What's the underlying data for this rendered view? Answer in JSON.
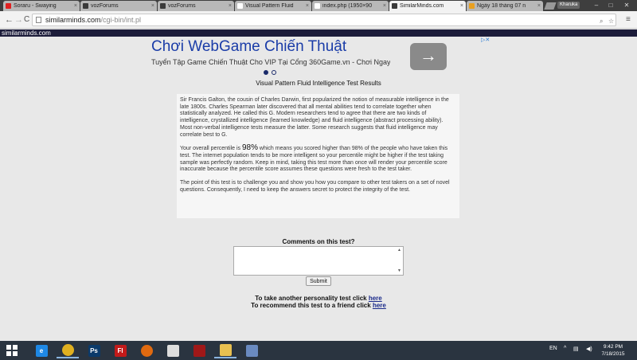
{
  "browser": {
    "tabs": [
      {
        "label": "Soraru - Swaying",
        "favicon_color": "#e02020"
      },
      {
        "label": "vozForums",
        "favicon_color": "#3a3a3a"
      },
      {
        "label": "vozForums",
        "favicon_color": "#3a3a3a"
      },
      {
        "label": "Visual Pattern Fluid",
        "favicon_color": "#ffffff"
      },
      {
        "label": "index.php (1950×90",
        "favicon_color": "#ffffff"
      },
      {
        "label": "SimilarMinds.com",
        "favicon_color": "#3a3a3a"
      },
      {
        "label": "Ngày 18 tháng 07 n",
        "favicon_color": "#e9a020"
      }
    ],
    "active_tab": 5,
    "tab_close": "×",
    "user_badge": "Kharuka",
    "url_host": "similarminds.com",
    "url_path": "/cgi-bin/int.pl",
    "back": "←",
    "forward": "→",
    "reload": "C",
    "zoom_glyph": "⌕",
    "star_glyph": "☆",
    "menu_glyph": "≡",
    "minimize": "–",
    "maximize": "□",
    "close": "✕"
  },
  "site": {
    "strip_text": "similarminds.com"
  },
  "ad": {
    "title": "Chơi WebGame Chiến Thuật",
    "subtitle": "Tuyển Tập Game Chiến Thuật Cho VIP Tại Cổng 360Game.vn - Chơi Ngay !",
    "arrow": "→",
    "choices_glyph": "▷✕"
  },
  "page": {
    "heading": "Visual Pattern Fluid Intelligence Test Results",
    "para1": "Sir Francis Galton, the cousin of Charles Darwin, first popularized the notion of measurable intelligence in the late 1800s. Charles Spearman later discovered that all mental abilities tend to correlate together when statistically analyzed. He called this G. Modern researchers tend to agree that there are two kinds of intelligence, crystallized intelligence (learned knowledge) and fluid intelligence (abstract processing ability). Most non-verbal intelligence tests measure the latter. Some research suggests that fluid intelligence may correlate best to G.",
    "percentile_prefix": "Your overall percentile is ",
    "percentile_value": "98%",
    "percentile_suffix": " which means you scored higher than 98% of the people who have taken this test. The internet population tends to be more intelligent so your percentile might be higher if the test taking sample was perfectly random. Keep in mind, taking this test more than once will render your percentile score inaccurate because the percentile score assumes these questions were fresh to the test taker.",
    "para3": "The point of this test is to challenge you and show you how you compare to other test takers on a set of novel questions. Consequently, I need to keep the answers secret to protect the integrity of the test.",
    "comments_label": "Comments on this test?",
    "comment_value": "",
    "submit_label": "Submit",
    "another_test_text": "To take another personality test click ",
    "another_test_link": "here",
    "recommend_text": "To recommend this test to a friend click ",
    "recommend_link": "here"
  },
  "taskbar": {
    "apps": [
      {
        "name": "internet-explorer",
        "glyph": "e",
        "color": "#1e88e5",
        "running": false
      },
      {
        "name": "chrome",
        "glyph": "",
        "color": "#e0b020",
        "running": true
      },
      {
        "name": "photoshop",
        "glyph": "Ps",
        "color": "#0b3a6a",
        "running": false
      },
      {
        "name": "flash",
        "glyph": "Fl",
        "color": "#c21a1a",
        "running": false
      },
      {
        "name": "firefox",
        "glyph": "",
        "color": "#e06a10",
        "running": false
      },
      {
        "name": "mahjong",
        "glyph": "",
        "color": "#dddddd",
        "running": false
      },
      {
        "name": "bag",
        "glyph": "",
        "color": "#a01818",
        "running": false
      },
      {
        "name": "file-explorer",
        "glyph": "",
        "color": "#e8c050",
        "running": true
      },
      {
        "name": "tool",
        "glyph": "",
        "color": "#6a8ac0",
        "running": false
      }
    ],
    "language": "EN",
    "time": "9:42 PM",
    "date": "7/18/2015"
  }
}
